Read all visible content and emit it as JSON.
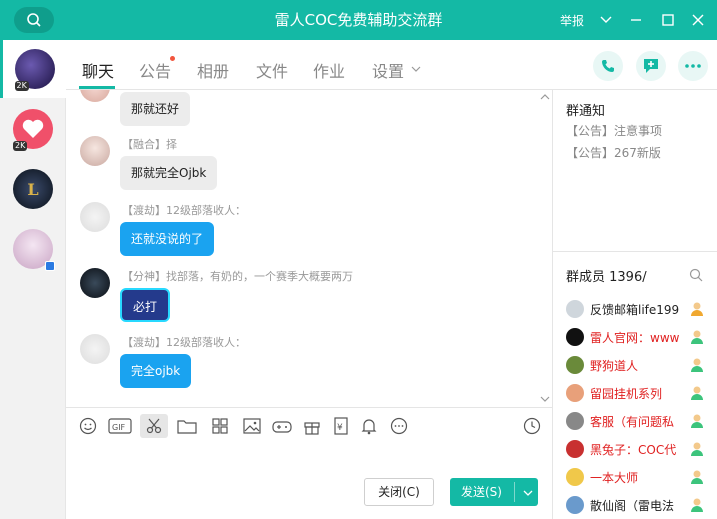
{
  "window": {
    "title": "雷人COC免费辅助交流群",
    "report_label": "举报"
  },
  "rail": {
    "items": [
      {
        "name": "group-coc",
        "badge": "2K",
        "color": "#3a2a6a"
      },
      {
        "name": "heart-app",
        "badge": "2K",
        "color": "#f0506a"
      },
      {
        "name": "league-app",
        "badge": "",
        "color": "#1e2a3a"
      },
      {
        "name": "anime-avatar",
        "badge": "",
        "color": "#e9d2e8"
      }
    ]
  },
  "tabs": [
    {
      "label": "聊天",
      "active": true
    },
    {
      "label": "公告",
      "active": false,
      "dot": true
    },
    {
      "label": "相册",
      "active": false
    },
    {
      "label": "文件",
      "active": false
    },
    {
      "label": "作业",
      "active": false
    },
    {
      "label": "设置",
      "active": false
    }
  ],
  "messages": [
    {
      "sender": "",
      "text": "那就还好",
      "style": "gray"
    },
    {
      "sender": "【融合】择",
      "text": "那就完全Ojbk",
      "style": "gray"
    },
    {
      "sender": "【渡劫】12级部落收人：",
      "text": "还就没说的了",
      "style": "blue"
    },
    {
      "sender": "【分神】找部落，有奶的，一个赛季大概要两万",
      "text": "必打",
      "style": "dark"
    },
    {
      "sender": "【渡劫】12级部落收人：",
      "text": "完全ojbk",
      "style": "blue"
    }
  ],
  "composer": {
    "close_label": "关闭(C)",
    "send_label": "发送(S)",
    "tools": [
      "emoji-icon",
      "gif-icon",
      "scissors-icon",
      "folder-icon",
      "doc-icon",
      "image-icon",
      "gamepad-icon",
      "gift-icon",
      "receipt-icon",
      "bell-icon",
      "more-icon"
    ]
  },
  "notice": {
    "title": "群通知",
    "items": [
      "【公告】注意事项",
      "【公告】267新版"
    ]
  },
  "members": {
    "title": "群成员 1396/",
    "list": [
      {
        "name": "反馈邮箱life199",
        "color": "#222",
        "avatar": "#cfd6dc"
      },
      {
        "name": "雷人官网：www",
        "color": "#e02020",
        "avatar": "#111"
      },
      {
        "name": "野狗道人",
        "color": "#e02020",
        "avatar": "#6a8a3a"
      },
      {
        "name": "留园挂机系列",
        "color": "#e02020",
        "avatar": "#e8a07a"
      },
      {
        "name": "客服（有问题私",
        "color": "#e02020",
        "avatar": "#888"
      },
      {
        "name": "黑兔子：COC代",
        "color": "#e02020",
        "avatar": "#c83030"
      },
      {
        "name": "一本大师",
        "color": "#e02020",
        "avatar": "#f0c84a"
      },
      {
        "name": "散仙阁（雷电法",
        "color": "#222",
        "avatar": "#6a9acc"
      }
    ]
  }
}
